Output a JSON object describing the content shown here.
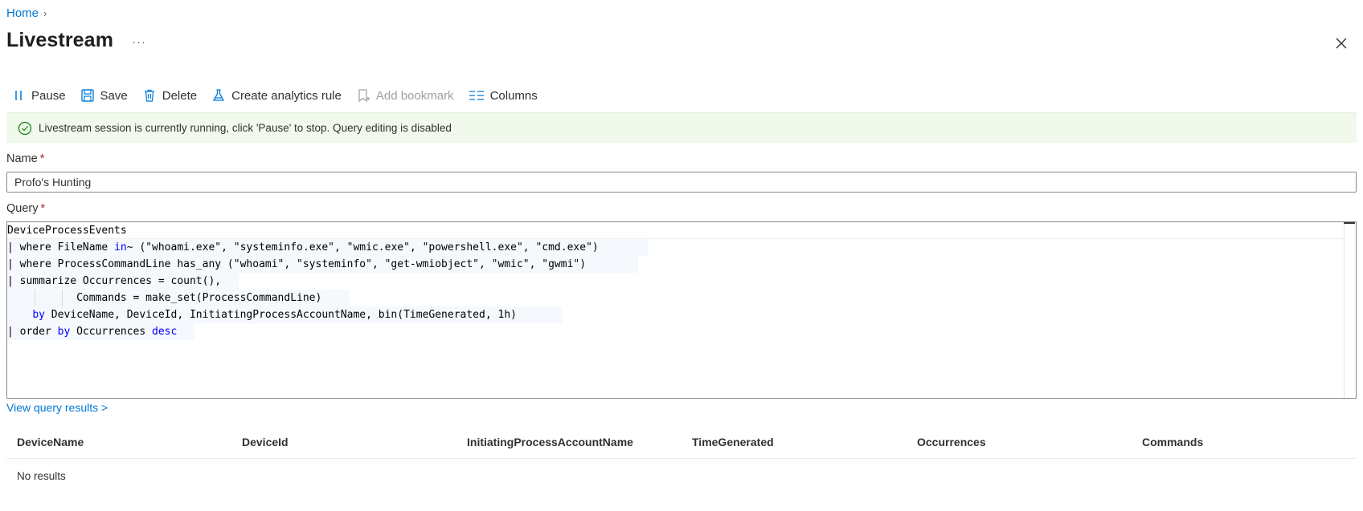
{
  "breadcrumb": {
    "home": "Home",
    "separator": "›"
  },
  "page": {
    "title": "Livestream",
    "more": "···"
  },
  "toolbar": {
    "pause": "Pause",
    "save": "Save",
    "delete": "Delete",
    "create_rule": "Create analytics rule",
    "add_bookmark": "Add bookmark",
    "columns": "Columns"
  },
  "banner": {
    "text": "Livestream session is currently running, click 'Pause' to stop. Query editing is disabled",
    "color": "#107c10"
  },
  "name_field": {
    "label": "Name",
    "required": "*",
    "value": "Profo's Hunting"
  },
  "query_field": {
    "label": "Query",
    "required": "*",
    "lines": [
      {
        "pre": "DeviceProcessEvents",
        "kw": "",
        "post": ""
      },
      {
        "pre": "| where FileName ",
        "kw": "in",
        "post": "~ (\"whoami.exe\", \"systeminfo.exe\", \"wmic.exe\", \"powershell.exe\", \"cmd.exe\")"
      },
      {
        "pre": "| where ProcessCommandLine has_any (\"whoami\", \"systeminfo\", \"get-wmiobject\", \"wmic\", \"gwmi\")",
        "kw": "",
        "post": ""
      },
      {
        "pre": "| summarize Occurrences = count(),",
        "kw": "",
        "post": ""
      },
      {
        "pre": "           Commands = make_set(ProcessCommandLine)",
        "kw": "",
        "post": ""
      },
      {
        "pre": "    ",
        "kw": "by",
        "post": " DeviceName, DeviceId, InitiatingProcessAccountName, bin(TimeGenerated, 1h)"
      },
      {
        "pre": "| order ",
        "kw": "by",
        "post": " Occurrences ",
        "kw2": "desc"
      }
    ]
  },
  "view_results": "View query results >",
  "results": {
    "columns": [
      "DeviceName",
      "DeviceId",
      "InitiatingProcessAccountName",
      "TimeGenerated",
      "Occurrences",
      "Commands"
    ],
    "empty_text": "No results"
  },
  "colors": {
    "accent": "#0078d4",
    "keyword": "#0000ff",
    "required": "#a4262c",
    "banner_bg": "#f0f9ec"
  }
}
